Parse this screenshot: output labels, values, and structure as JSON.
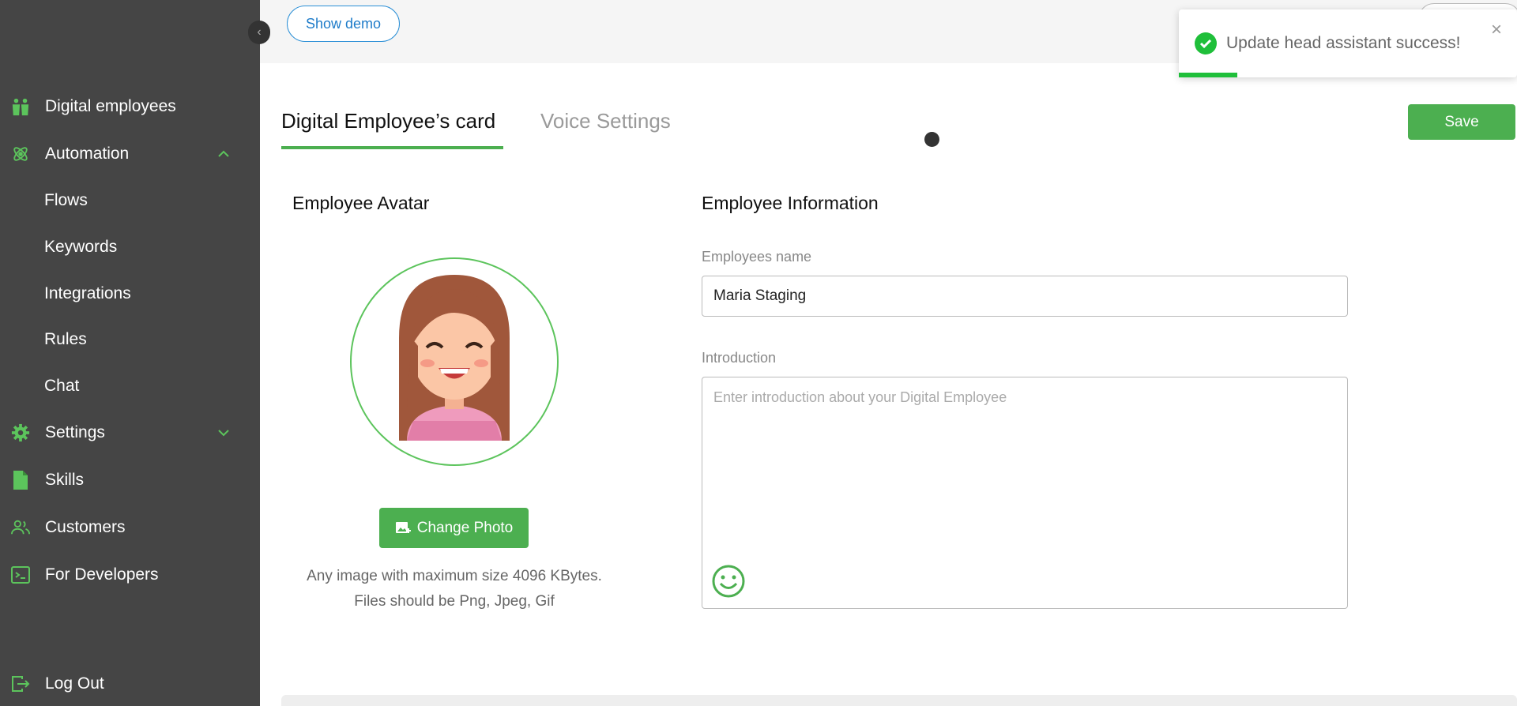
{
  "sidebar": {
    "collapse_glyph": "‹",
    "items": [
      {
        "label": "Digital employees",
        "icon": "people-icon"
      },
      {
        "label": "Automation",
        "icon": "atom-icon",
        "expanded": true
      },
      {
        "label": "Flows"
      },
      {
        "label": "Keywords"
      },
      {
        "label": "Integrations"
      },
      {
        "label": "Rules"
      },
      {
        "label": "Chat"
      },
      {
        "label": "Settings",
        "icon": "gear-icon",
        "expanded": false
      },
      {
        "label": "Skills",
        "icon": "document-icon"
      },
      {
        "label": "Customers",
        "icon": "customers-icon"
      },
      {
        "label": "For Developers",
        "icon": "terminal-icon"
      }
    ],
    "logout_label": "Log Out"
  },
  "topbar": {
    "show_demo_label": "Show demo"
  },
  "toast": {
    "message": "Update head assistant success!",
    "close_glyph": "×",
    "status": "success"
  },
  "tabs": {
    "card_label": "Digital Employee’s card",
    "voice_label": "Voice Settings",
    "active": "card"
  },
  "save_label": "Save",
  "avatar_section": {
    "title": "Employee Avatar",
    "change_photo_label": "Change Photo",
    "hint_line1": "Any image with maximum size 4096 KBytes.",
    "hint_line2": "Files should be Png, Jpeg, Gif"
  },
  "info_section": {
    "title": "Employee Information",
    "name_label": "Employees name",
    "name_value": "Maria Staging",
    "intro_label": "Introduction",
    "intro_placeholder": "Enter introduction about your Digital Employee",
    "intro_value": ""
  },
  "colors": {
    "accent": "#4caf50",
    "sidebar_bg": "#454545",
    "link_blue": "#1f7cc9",
    "toast_success": "#1fbf3a"
  }
}
